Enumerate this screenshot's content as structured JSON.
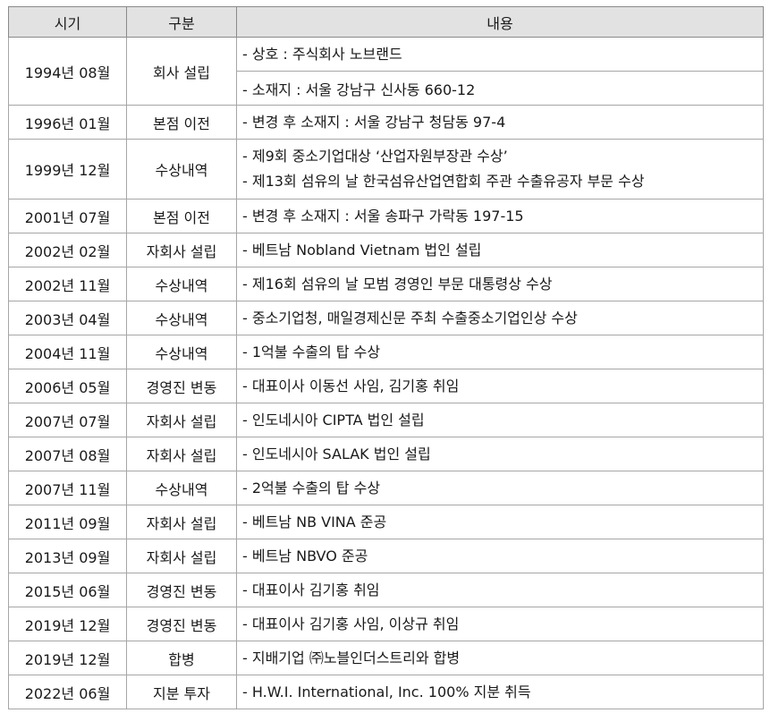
{
  "headers": {
    "date": "시기",
    "category": "구분",
    "content": "내용"
  },
  "rows": [
    {
      "date": "1994년 08월",
      "category": "회사 설립",
      "lines": [
        "- 상호 : 주식회사 노브랜드"
      ],
      "sub": "- 소재지 : 서울 강남구 신사동 660-12"
    },
    {
      "date": "1996년 01월",
      "category": "본점 이전",
      "lines": [
        "- 변경 후 소재지 : 서울 강남구 청담동 97-4"
      ]
    },
    {
      "date": "1999년 12월",
      "category": "수상내역",
      "lines": [
        "- 제9회 중소기업대상 ‘산업자원부장관 수상’",
        "- 제13회 섬유의 날 한국섬유산업연합회 주관 수출유공자 부문 수상"
      ]
    },
    {
      "date": "2001년 07월",
      "category": "본점 이전",
      "lines": [
        "- 변경 후 소재지 : 서울 송파구 가락동 197-15"
      ]
    },
    {
      "date": "2002년 02월",
      "category": "자회사 설립",
      "lines": [
        "- 베트남 Nobland Vietnam 법인 설립"
      ]
    },
    {
      "date": "2002년 11월",
      "category": "수상내역",
      "lines": [
        "- 제16회 섬유의 날 모범 경영인 부문 대통령상 수상"
      ]
    },
    {
      "date": "2003년 04월",
      "category": "수상내역",
      "lines": [
        "- 중소기업청, 매일경제신문 주최 수출중소기업인상 수상"
      ]
    },
    {
      "date": "2004년 11월",
      "category": "수상내역",
      "lines": [
        "- 1억불 수출의 탑 수상"
      ]
    },
    {
      "date": "2006년 05월",
      "category": "경영진 변동",
      "lines": [
        "- 대표이사 이동선 사임, 김기홍 취임"
      ]
    },
    {
      "date": "2007년 07월",
      "category": "자회사 설립",
      "lines": [
        "- 인도네시아 CIPTA 법인 설립"
      ]
    },
    {
      "date": "2007년 08월",
      "category": "자회사 설립",
      "lines": [
        "- 인도네시아 SALAK 법인 설립"
      ]
    },
    {
      "date": "2007년 11월",
      "category": "수상내역",
      "lines": [
        "- 2억불 수출의 탑 수상"
      ]
    },
    {
      "date": "2011년 09월",
      "category": "자회사 설립",
      "lines": [
        "- 베트남 NB VINA 준공"
      ]
    },
    {
      "date": "2013년 09월",
      "category": "자회사 설립",
      "lines": [
        "- 베트남 NBVO 준공"
      ]
    },
    {
      "date": "2015년 06월",
      "category": "경영진 변동",
      "lines": [
        "- 대표이사 김기홍 취임"
      ]
    },
    {
      "date": "2019년 12월",
      "category": "경영진 변동",
      "lines": [
        "- 대표이사 김기홍 사임, 이상규 취임"
      ]
    },
    {
      "date": "2019년 12월",
      "category": "합병",
      "lines": [
        "- 지배기업 ㈜노블인더스트리와 합병"
      ]
    },
    {
      "date": "2022년 06월",
      "category": "지분 투자",
      "lines": [
        "- H.W.I. International, Inc. 100% 지분 취득"
      ]
    }
  ]
}
